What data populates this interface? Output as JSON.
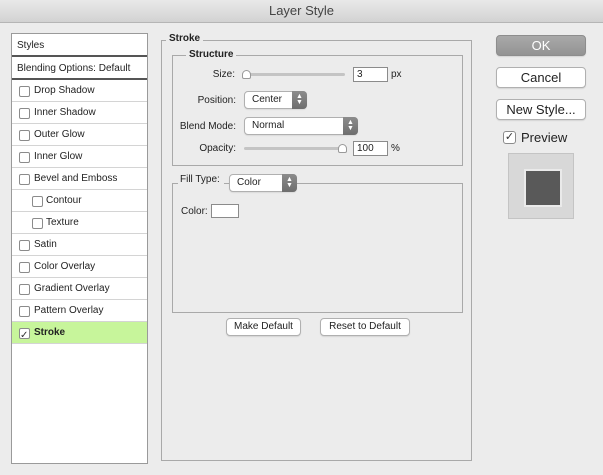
{
  "window": {
    "title": "Layer Style"
  },
  "styles_list": {
    "header": "Styles",
    "blending_options": "Blending Options: Default",
    "items": [
      {
        "label": "Drop Shadow",
        "checked": false,
        "sub": false,
        "selected": false
      },
      {
        "label": "Inner Shadow",
        "checked": false,
        "sub": false,
        "selected": false
      },
      {
        "label": "Outer Glow",
        "checked": false,
        "sub": false,
        "selected": false
      },
      {
        "label": "Inner Glow",
        "checked": false,
        "sub": false,
        "selected": false
      },
      {
        "label": "Bevel and Emboss",
        "checked": false,
        "sub": false,
        "selected": false
      },
      {
        "label": "Contour",
        "checked": false,
        "sub": true,
        "selected": false
      },
      {
        "label": "Texture",
        "checked": false,
        "sub": true,
        "selected": false
      },
      {
        "label": "Satin",
        "checked": false,
        "sub": false,
        "selected": false
      },
      {
        "label": "Color Overlay",
        "checked": false,
        "sub": false,
        "selected": false
      },
      {
        "label": "Gradient Overlay",
        "checked": false,
        "sub": false,
        "selected": false
      },
      {
        "label": "Pattern Overlay",
        "checked": false,
        "sub": false,
        "selected": false
      },
      {
        "label": "Stroke",
        "checked": true,
        "sub": false,
        "selected": true
      }
    ]
  },
  "stroke": {
    "title": "Stroke",
    "structure_title": "Structure",
    "size_label": "Size:",
    "size_value": "3",
    "size_unit": "px",
    "size_slider_fraction": 0.0,
    "position_label": "Position:",
    "position_value": "Center",
    "blend_label": "Blend Mode:",
    "blend_value": "Normal",
    "opacity_label": "Opacity:",
    "opacity_value": "100",
    "opacity_unit": "%",
    "opacity_slider_fraction": 1.0,
    "fill_type_label": "Fill Type:",
    "fill_type_value": "Color",
    "color_label": "Color:",
    "color_value": "#ffffff",
    "make_default": "Make Default",
    "reset_default": "Reset to Default"
  },
  "buttons": {
    "ok": "OK",
    "cancel": "Cancel",
    "new_style": "New Style...",
    "preview_label": "Preview",
    "preview_checked": true
  },
  "colors": {
    "selected_row": "#c7f59b",
    "preview_fill": "#595959"
  }
}
